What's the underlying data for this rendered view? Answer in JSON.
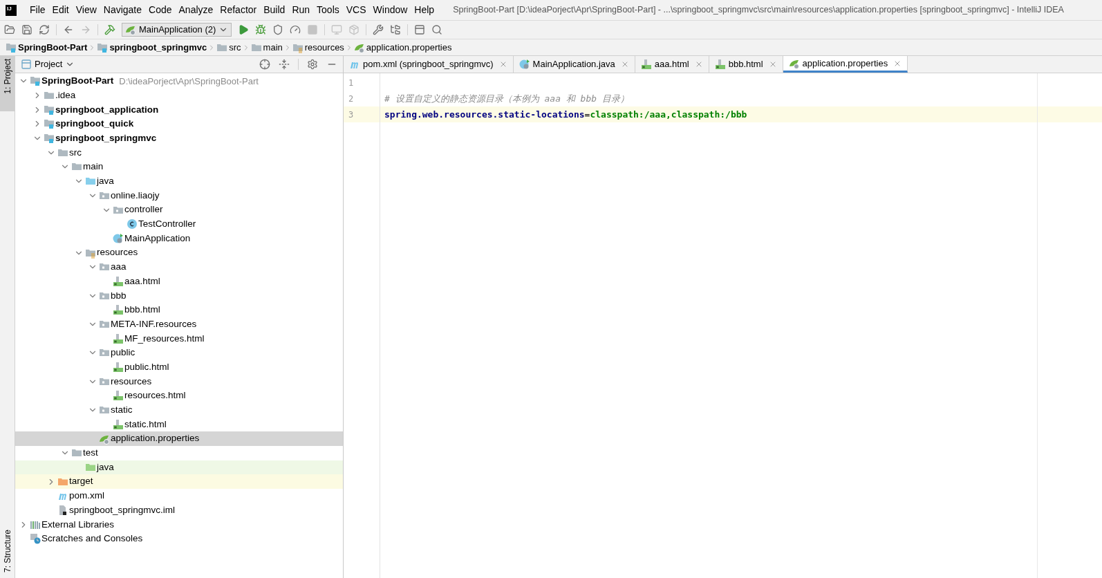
{
  "title_bar": {
    "logo": "IJ",
    "menu": [
      "File",
      "Edit",
      "View",
      "Navigate",
      "Code",
      "Analyze",
      "Refactor",
      "Build",
      "Run",
      "Tools",
      "VCS",
      "Window",
      "Help"
    ],
    "title": "SpringBoot-Part [D:\\ideaPorject\\Apr\\SpringBoot-Part] - ...\\springboot_springmvc\\src\\main\\resources\\application.properties [springboot_springmvc] - IntelliJ IDEA"
  },
  "toolbar": {
    "run_config": "MainApplication (2)"
  },
  "breadcrumbs": [
    {
      "label": "SpringBoot-Part",
      "kind": "module",
      "bold": true
    },
    {
      "label": "springboot_springmvc",
      "kind": "module",
      "bold": true
    },
    {
      "label": "src",
      "kind": "folder",
      "bold": false
    },
    {
      "label": "main",
      "kind": "folder",
      "bold": false
    },
    {
      "label": "resources",
      "kind": "resources",
      "bold": false
    },
    {
      "label": "application.properties",
      "kind": "properties",
      "bold": false
    }
  ],
  "side_stripe": {
    "top": "1: Project",
    "bottom": "7: Structure"
  },
  "project_panel": {
    "title": "Project",
    "tree": [
      {
        "label": "SpringBoot-Part",
        "path": "D:\\ideaPorject\\Apr\\SpringBoot-Part",
        "kind": "module",
        "bold": true,
        "expanded": true,
        "selected": false,
        "children": [
          {
            "label": ".idea",
            "kind": "folder",
            "bold": false,
            "expanded": false,
            "selected": false
          },
          {
            "label": "springboot_application",
            "kind": "module",
            "bold": true,
            "expanded": false,
            "selected": false
          },
          {
            "label": "springboot_quick",
            "kind": "module",
            "bold": true,
            "expanded": false,
            "selected": false
          },
          {
            "label": "springboot_springmvc",
            "kind": "module",
            "bold": true,
            "expanded": true,
            "selected": false,
            "children": [
              {
                "label": "src",
                "kind": "folder",
                "bold": false,
                "expanded": true,
                "selected": false,
                "children": [
                  {
                    "label": "main",
                    "kind": "folder",
                    "bold": false,
                    "expanded": true,
                    "selected": false,
                    "children": [
                      {
                        "label": "java",
                        "kind": "source",
                        "bold": false,
                        "expanded": true,
                        "selected": false,
                        "children": [
                          {
                            "label": "online.liaojy",
                            "kind": "package",
                            "bold": false,
                            "expanded": true,
                            "selected": false,
                            "children": [
                              {
                                "label": "controller",
                                "kind": "package",
                                "bold": false,
                                "expanded": true,
                                "selected": false,
                                "children": [
                                  {
                                    "label": "TestController",
                                    "kind": "class",
                                    "bold": false,
                                    "selected": false
                                  }
                                ]
                              },
                              {
                                "label": "MainApplication",
                                "kind": "boot",
                                "bold": false,
                                "selected": false
                              }
                            ]
                          }
                        ]
                      },
                      {
                        "label": "resources",
                        "kind": "resources",
                        "bold": false,
                        "expanded": true,
                        "selected": false,
                        "children": [
                          {
                            "label": "aaa",
                            "kind": "package",
                            "bold": false,
                            "expanded": true,
                            "selected": false,
                            "children": [
                              {
                                "label": "aaa.html",
                                "kind": "html",
                                "bold": false,
                                "selected": false
                              }
                            ]
                          },
                          {
                            "label": "bbb",
                            "kind": "package",
                            "bold": false,
                            "expanded": true,
                            "selected": false,
                            "children": [
                              {
                                "label": "bbb.html",
                                "kind": "html",
                                "bold": false,
                                "selected": false
                              }
                            ]
                          },
                          {
                            "label": "META-INF.resources",
                            "kind": "package",
                            "bold": false,
                            "expanded": true,
                            "selected": false,
                            "children": [
                              {
                                "label": "MF_resources.html",
                                "kind": "html",
                                "bold": false,
                                "selected": false
                              }
                            ]
                          },
                          {
                            "label": "public",
                            "kind": "package",
                            "bold": false,
                            "expanded": true,
                            "selected": false,
                            "children": [
                              {
                                "label": "public.html",
                                "kind": "html",
                                "bold": false,
                                "selected": false
                              }
                            ]
                          },
                          {
                            "label": "resources",
                            "kind": "package",
                            "bold": false,
                            "expanded": true,
                            "selected": false,
                            "children": [
                              {
                                "label": "resources.html",
                                "kind": "html",
                                "bold": false,
                                "selected": false
                              }
                            ]
                          },
                          {
                            "label": "static",
                            "kind": "package",
                            "bold": false,
                            "expanded": true,
                            "selected": false,
                            "children": [
                              {
                                "label": "static.html",
                                "kind": "html",
                                "bold": false,
                                "selected": false
                              }
                            ]
                          },
                          {
                            "label": "application.properties",
                            "kind": "properties",
                            "bold": false,
                            "selected": true
                          }
                        ]
                      }
                    ]
                  },
                  {
                    "label": "test",
                    "kind": "folder",
                    "bold": false,
                    "expanded": true,
                    "selected": false,
                    "children": [
                      {
                        "label": "java",
                        "kind": "test",
                        "bold": false,
                        "selected": false
                      }
                    ]
                  }
                ]
              },
              {
                "label": "target",
                "kind": "excluded",
                "bold": false,
                "expanded": false,
                "selected": false
              },
              {
                "label": "pom.xml",
                "kind": "maven",
                "bold": false,
                "selected": false
              },
              {
                "label": "springboot_springmvc.iml",
                "kind": "iml",
                "bold": false,
                "selected": false
              }
            ]
          }
        ]
      },
      {
        "label": "External Libraries",
        "kind": "libraries",
        "bold": false,
        "expanded": false,
        "selected": false
      },
      {
        "label": "Scratches and Consoles",
        "kind": "scratches",
        "bold": false,
        "selected": false
      }
    ]
  },
  "editor_tabs": [
    {
      "label": "pom.xml (springboot_springmvc)",
      "kind": "maven",
      "selected": false
    },
    {
      "label": "MainApplication.java",
      "kind": "boot",
      "selected": false
    },
    {
      "label": "aaa.html",
      "kind": "html",
      "selected": false
    },
    {
      "label": "bbb.html",
      "kind": "html",
      "selected": false
    },
    {
      "label": "application.properties",
      "kind": "properties",
      "selected": true
    }
  ],
  "editor": {
    "lines": [
      {
        "number": "1",
        "current": false
      },
      {
        "number": "2",
        "current": false,
        "tokens": [
          {
            "kind": "comment",
            "text": "# 设置自定义的静态资源目录（本例为 aaa 和 bbb 目录）"
          }
        ]
      },
      {
        "number": "3",
        "current": true,
        "tokens": [
          {
            "kind": "key",
            "text": "spring.web.resources.static-locations"
          },
          {
            "kind": "operator",
            "text": "="
          },
          {
            "kind": "value",
            "text": "classpath:/aaa,classpath:/bbb"
          }
        ]
      }
    ]
  }
}
